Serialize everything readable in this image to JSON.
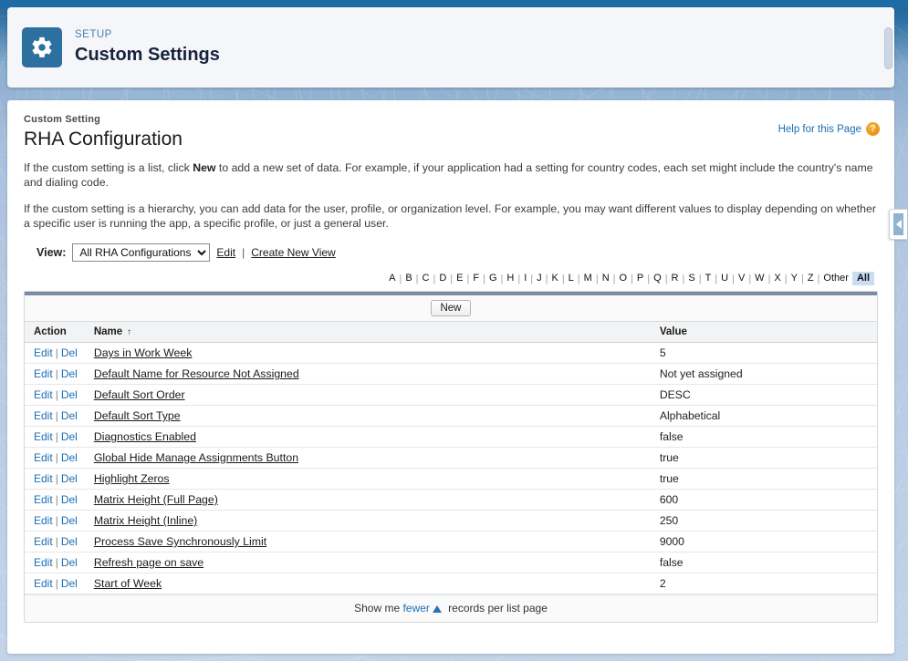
{
  "setup_header": {
    "icon": "gear-icon",
    "eyebrow": "SETUP",
    "title": "Custom Settings"
  },
  "content": {
    "breadcrumb_label": "Custom Setting",
    "object_title": "RHA Configuration",
    "help_link": "Help for this Page",
    "help_icon": "question-mark-icon",
    "description_1_before": "If the custom setting is a list, click ",
    "description_1_bold": "New",
    "description_1_after": " to add a new set of data. For example, if your application had a setting for country codes, each set might include the country's name and dialing code.",
    "description_2": "If the custom setting is a hierarchy, you can add data for the user, profile, or organization level. For example, you may want different values to display depending on whether a specific user is running the app, a specific profile, or just a general user."
  },
  "view_bar": {
    "label": "View:",
    "selected": "All RHA Configurations",
    "options": [
      "All RHA Configurations"
    ],
    "edit_link": "Edit",
    "separator": "|",
    "create_link": "Create New View"
  },
  "alpha_filter": {
    "letters": [
      "A",
      "B",
      "C",
      "D",
      "E",
      "F",
      "G",
      "H",
      "I",
      "J",
      "K",
      "L",
      "M",
      "N",
      "O",
      "P",
      "Q",
      "R",
      "S",
      "T",
      "U",
      "V",
      "W",
      "X",
      "Y",
      "Z"
    ],
    "other_label": "Other",
    "all_label": "All",
    "active": "All"
  },
  "list_view": {
    "new_button": "New",
    "columns": [
      "Action",
      "Name",
      "Value"
    ],
    "sort_column": "Name",
    "sort_caret": "↑",
    "action_edit": "Edit",
    "action_pipe": "|",
    "action_del": "Del",
    "rows": [
      {
        "name": "Days in Work Week",
        "value": "5"
      },
      {
        "name": "Default Name for Resource Not Assigned",
        "value": "Not yet assigned"
      },
      {
        "name": "Default Sort Order",
        "value": "DESC"
      },
      {
        "name": "Default Sort Type",
        "value": "Alphabetical"
      },
      {
        "name": "Diagnostics Enabled",
        "value": "false"
      },
      {
        "name": "Global Hide Manage Assignments Button",
        "value": "true"
      },
      {
        "name": "Highlight Zeros",
        "value": "true"
      },
      {
        "name": "Matrix Height (Full Page)",
        "value": "600"
      },
      {
        "name": "Matrix Height (Inline)",
        "value": "250"
      },
      {
        "name": "Process Save Synchronously Limit",
        "value": "9000"
      },
      {
        "name": "Refresh page on save",
        "value": "false"
      },
      {
        "name": "Start of Week",
        "value": "2"
      }
    ],
    "footer_before": "Show me ",
    "footer_link": "fewer",
    "footer_after": " records per list page"
  },
  "sidebar_toggle": {
    "icon": "chevron-left-icon"
  },
  "colors": {
    "brand_blue": "#1e6ca5",
    "icon_tile": "#2d6f9e",
    "link_blue": "#1b6fb5",
    "eyebrow_blue": "#4a80b5",
    "help_orange": "#e8921a",
    "list_topbar": "#7e8ba6",
    "alpha_active_bg": "#c8dcf2"
  }
}
